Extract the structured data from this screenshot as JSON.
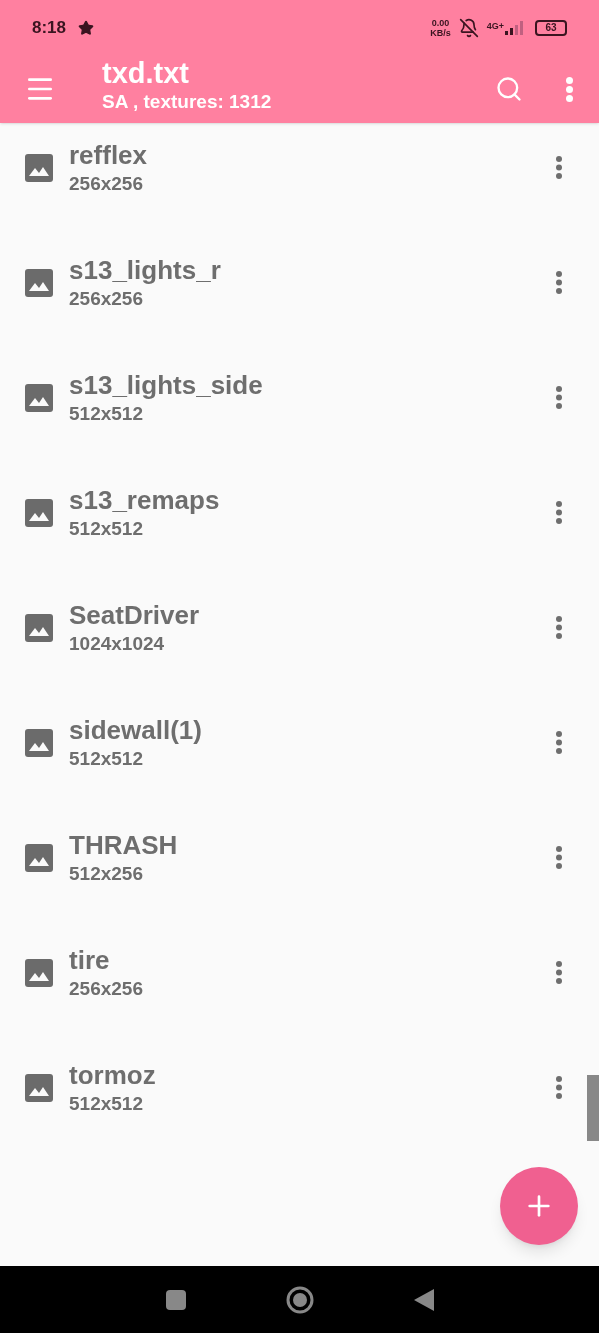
{
  "status_bar": {
    "time": "8:18",
    "speed_value": "0.00",
    "speed_unit": "KB/s",
    "network": "4G+",
    "battery": "63"
  },
  "app_bar": {
    "title": "txd.txt",
    "subtitle": "SA , textures: 1312"
  },
  "textures": [
    {
      "name": "refflex",
      "size": "256x256"
    },
    {
      "name": "s13_lights_r",
      "size": "256x256"
    },
    {
      "name": "s13_lights_side",
      "size": "512x512"
    },
    {
      "name": "s13_remaps",
      "size": "512x512"
    },
    {
      "name": "SeatDriver",
      "size": "1024x1024"
    },
    {
      "name": "sidewall(1)",
      "size": "512x512"
    },
    {
      "name": "THRASH",
      "size": "512x256"
    },
    {
      "name": "tire",
      "size": "256x256"
    },
    {
      "name": "tormoz",
      "size": "512x512"
    }
  ]
}
